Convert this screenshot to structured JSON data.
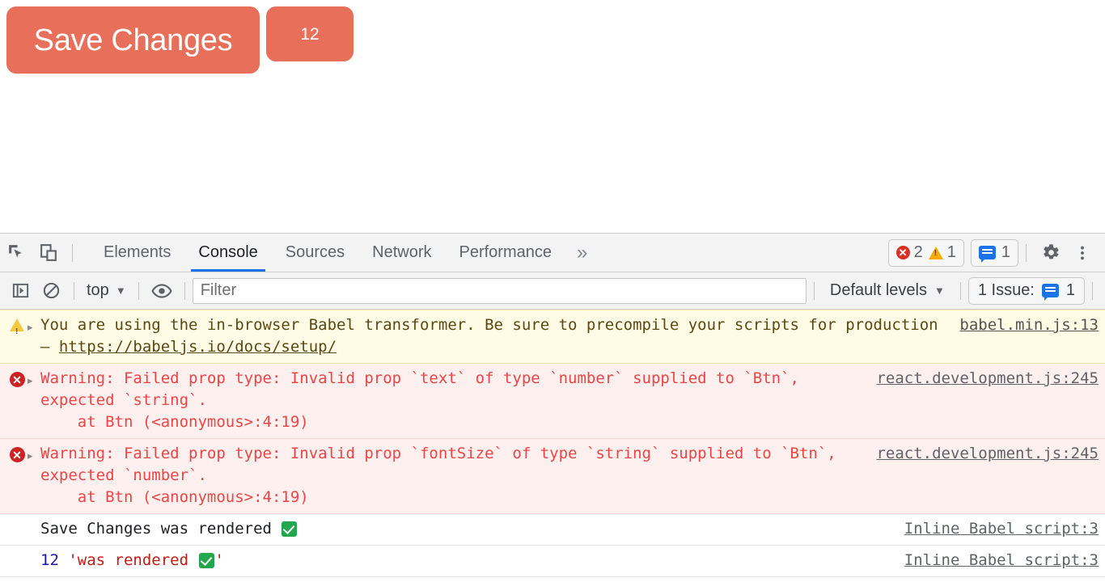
{
  "page": {
    "save_button_label": "Save Changes",
    "count_button_label": "12",
    "button_color": "#e8705a"
  },
  "devtools": {
    "toolbar": {
      "inspect_icon": "inspect-cursor-icon",
      "device_icon": "device-toolbar-icon",
      "tabs": [
        {
          "label": "Elements",
          "active": false
        },
        {
          "label": "Console",
          "active": true
        },
        {
          "label": "Sources",
          "active": false
        },
        {
          "label": "Network",
          "active": false
        },
        {
          "label": "Performance",
          "active": false
        }
      ],
      "more_tabs_label": "»",
      "error_count": "2",
      "warning_count": "1",
      "issue_count": "1",
      "settings_icon": "gear-icon",
      "menu_icon": "kebab-menu-icon",
      "active_tab_underline_color": "#1a73e8"
    },
    "filterbar": {
      "sidebar_toggle_icon": "console-sidebar-icon",
      "clear_icon": "clear-console-icon",
      "context_label": "top",
      "eye_icon": "live-expression-icon",
      "filter_placeholder": "Filter",
      "filter_value": "",
      "levels_label": "Default levels",
      "issues_label": "1 Issue:",
      "issues_count": "1"
    },
    "messages": [
      {
        "type": "warn",
        "icon": "warning-triangle-icon",
        "expandable": true,
        "text_before_link": "You are using the in-browser Babel transformer. Be sure to precompile your scripts for production – ",
        "inline_link": "https://babeljs.io/docs/setup/",
        "text_after_link": "",
        "source": "babel.min.js:13"
      },
      {
        "type": "error",
        "icon": "error-circle-icon",
        "expandable": true,
        "text_before_link": "Warning: Failed prop type: Invalid prop `text` of type `number` supplied to `Btn`, expected `string`.\n    at Btn (<anonymous>:4:19)",
        "inline_link": "",
        "text_after_link": "",
        "source": "react.development.js:245"
      },
      {
        "type": "error",
        "icon": "error-circle-icon",
        "expandable": true,
        "text_before_link": "Warning: Failed prop type: Invalid prop `fontSize` of type `string` supplied to `Btn`, expected `number`.\n    at Btn (<anonymous>:4:19)",
        "inline_link": "",
        "text_after_link": "",
        "source": "react.development.js:245"
      },
      {
        "type": "log",
        "icon": "",
        "expandable": false,
        "text_before_link": "Save Changes was rendered ",
        "inline_link": "",
        "text_after_link": "",
        "source": "Inline Babel script:3"
      },
      {
        "type": "log",
        "icon": "",
        "expandable": false,
        "text_before_link": "",
        "inline_link": "",
        "text_after_link": "",
        "source": "Inline Babel script:3",
        "tokens": {
          "number": "12",
          "string": "'was rendered ",
          "string_end": "'"
        }
      }
    ]
  }
}
